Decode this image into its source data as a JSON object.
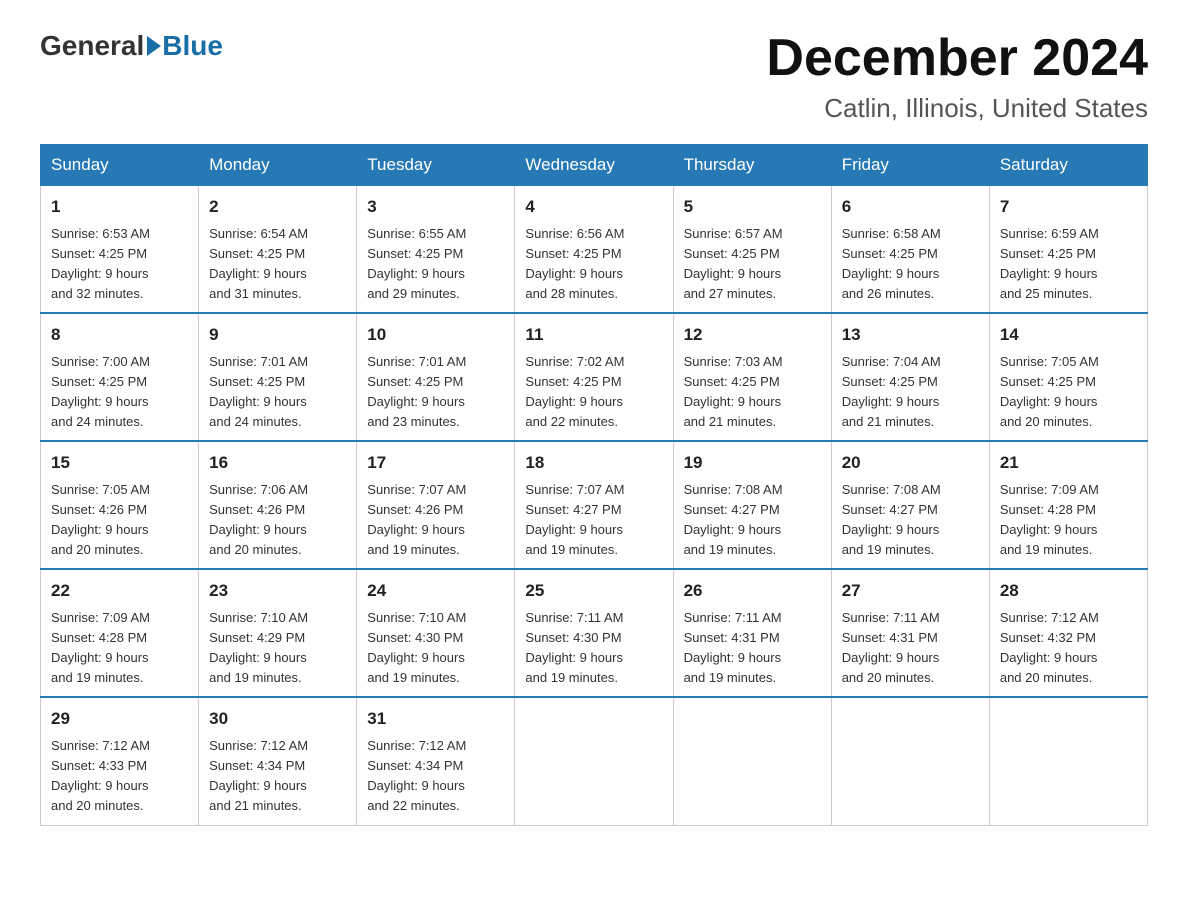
{
  "header": {
    "logo_general": "General",
    "logo_blue": "Blue",
    "month_title": "December 2024",
    "location": "Catlin, Illinois, United States"
  },
  "days_of_week": [
    "Sunday",
    "Monday",
    "Tuesday",
    "Wednesday",
    "Thursday",
    "Friday",
    "Saturday"
  ],
  "weeks": [
    [
      {
        "day": "1",
        "sunrise": "6:53 AM",
        "sunset": "4:25 PM",
        "daylight": "9 hours and 32 minutes."
      },
      {
        "day": "2",
        "sunrise": "6:54 AM",
        "sunset": "4:25 PM",
        "daylight": "9 hours and 31 minutes."
      },
      {
        "day": "3",
        "sunrise": "6:55 AM",
        "sunset": "4:25 PM",
        "daylight": "9 hours and 29 minutes."
      },
      {
        "day": "4",
        "sunrise": "6:56 AM",
        "sunset": "4:25 PM",
        "daylight": "9 hours and 28 minutes."
      },
      {
        "day": "5",
        "sunrise": "6:57 AM",
        "sunset": "4:25 PM",
        "daylight": "9 hours and 27 minutes."
      },
      {
        "day": "6",
        "sunrise": "6:58 AM",
        "sunset": "4:25 PM",
        "daylight": "9 hours and 26 minutes."
      },
      {
        "day": "7",
        "sunrise": "6:59 AM",
        "sunset": "4:25 PM",
        "daylight": "9 hours and 25 minutes."
      }
    ],
    [
      {
        "day": "8",
        "sunrise": "7:00 AM",
        "sunset": "4:25 PM",
        "daylight": "9 hours and 24 minutes."
      },
      {
        "day": "9",
        "sunrise": "7:01 AM",
        "sunset": "4:25 PM",
        "daylight": "9 hours and 24 minutes."
      },
      {
        "day": "10",
        "sunrise": "7:01 AM",
        "sunset": "4:25 PM",
        "daylight": "9 hours and 23 minutes."
      },
      {
        "day": "11",
        "sunrise": "7:02 AM",
        "sunset": "4:25 PM",
        "daylight": "9 hours and 22 minutes."
      },
      {
        "day": "12",
        "sunrise": "7:03 AM",
        "sunset": "4:25 PM",
        "daylight": "9 hours and 21 minutes."
      },
      {
        "day": "13",
        "sunrise": "7:04 AM",
        "sunset": "4:25 PM",
        "daylight": "9 hours and 21 minutes."
      },
      {
        "day": "14",
        "sunrise": "7:05 AM",
        "sunset": "4:25 PM",
        "daylight": "9 hours and 20 minutes."
      }
    ],
    [
      {
        "day": "15",
        "sunrise": "7:05 AM",
        "sunset": "4:26 PM",
        "daylight": "9 hours and 20 minutes."
      },
      {
        "day": "16",
        "sunrise": "7:06 AM",
        "sunset": "4:26 PM",
        "daylight": "9 hours and 20 minutes."
      },
      {
        "day": "17",
        "sunrise": "7:07 AM",
        "sunset": "4:26 PM",
        "daylight": "9 hours and 19 minutes."
      },
      {
        "day": "18",
        "sunrise": "7:07 AM",
        "sunset": "4:27 PM",
        "daylight": "9 hours and 19 minutes."
      },
      {
        "day": "19",
        "sunrise": "7:08 AM",
        "sunset": "4:27 PM",
        "daylight": "9 hours and 19 minutes."
      },
      {
        "day": "20",
        "sunrise": "7:08 AM",
        "sunset": "4:27 PM",
        "daylight": "9 hours and 19 minutes."
      },
      {
        "day": "21",
        "sunrise": "7:09 AM",
        "sunset": "4:28 PM",
        "daylight": "9 hours and 19 minutes."
      }
    ],
    [
      {
        "day": "22",
        "sunrise": "7:09 AM",
        "sunset": "4:28 PM",
        "daylight": "9 hours and 19 minutes."
      },
      {
        "day": "23",
        "sunrise": "7:10 AM",
        "sunset": "4:29 PM",
        "daylight": "9 hours and 19 minutes."
      },
      {
        "day": "24",
        "sunrise": "7:10 AM",
        "sunset": "4:30 PM",
        "daylight": "9 hours and 19 minutes."
      },
      {
        "day": "25",
        "sunrise": "7:11 AM",
        "sunset": "4:30 PM",
        "daylight": "9 hours and 19 minutes."
      },
      {
        "day": "26",
        "sunrise": "7:11 AM",
        "sunset": "4:31 PM",
        "daylight": "9 hours and 19 minutes."
      },
      {
        "day": "27",
        "sunrise": "7:11 AM",
        "sunset": "4:31 PM",
        "daylight": "9 hours and 20 minutes."
      },
      {
        "day": "28",
        "sunrise": "7:12 AM",
        "sunset": "4:32 PM",
        "daylight": "9 hours and 20 minutes."
      }
    ],
    [
      {
        "day": "29",
        "sunrise": "7:12 AM",
        "sunset": "4:33 PM",
        "daylight": "9 hours and 20 minutes."
      },
      {
        "day": "30",
        "sunrise": "7:12 AM",
        "sunset": "4:34 PM",
        "daylight": "9 hours and 21 minutes."
      },
      {
        "day": "31",
        "sunrise": "7:12 AM",
        "sunset": "4:34 PM",
        "daylight": "9 hours and 22 minutes."
      },
      null,
      null,
      null,
      null
    ]
  ],
  "labels": {
    "sunrise": "Sunrise:",
    "sunset": "Sunset:",
    "daylight": "Daylight:"
  }
}
